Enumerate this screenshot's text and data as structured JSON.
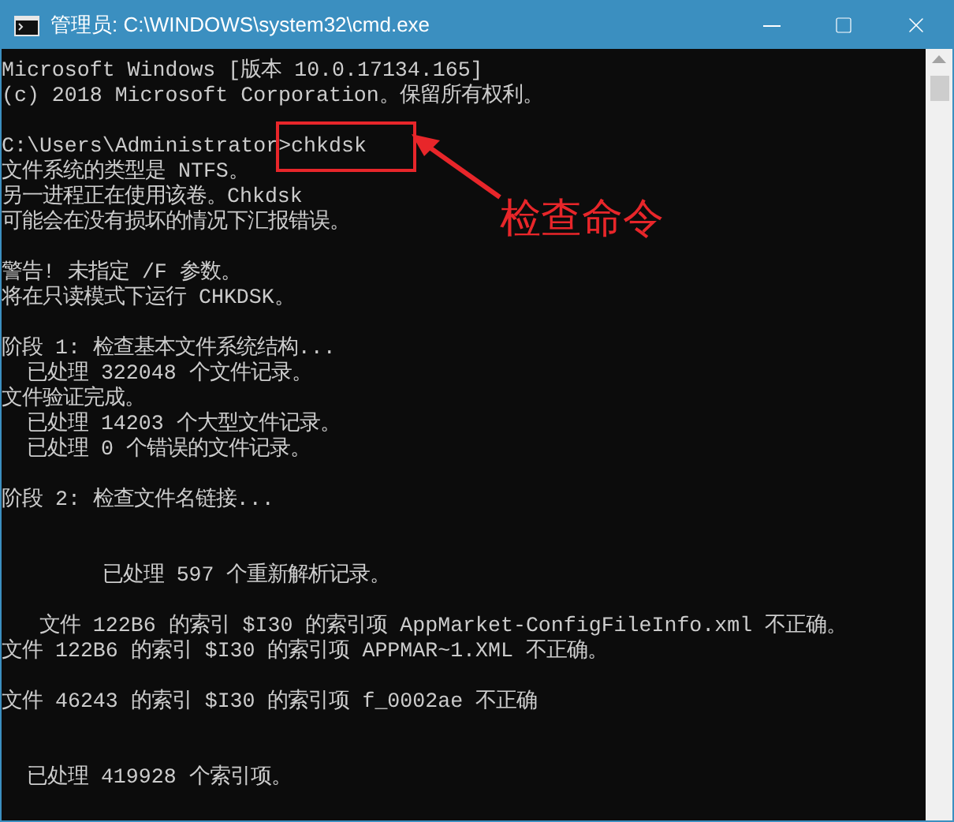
{
  "window": {
    "title": "管理员: C:\\WINDOWS\\system32\\cmd.exe"
  },
  "console": {
    "lines": [
      {
        "kind": "text",
        "text": "Microsoft Windows [版本 10.0.17134.165]"
      },
      {
        "kind": "text",
        "text": "(c) 2018 Microsoft Corporation。保留所有权利。"
      },
      {
        "kind": "blank"
      },
      {
        "kind": "prompt",
        "prompt": "C:\\Users\\Administrator",
        "command": ">chkdsk",
        "highlighted": true
      },
      {
        "kind": "text",
        "text": "文件系统的类型是 NTFS。"
      },
      {
        "kind": "text",
        "text": "另一进程正在使用该卷。Chkdsk"
      },
      {
        "kind": "text",
        "text": "可能会在没有损坏的情况下汇报错误。"
      },
      {
        "kind": "blank"
      },
      {
        "kind": "text",
        "text": "警告! 未指定 /F 参数。"
      },
      {
        "kind": "text",
        "text": "将在只读模式下运行 CHKDSK。"
      },
      {
        "kind": "blank"
      },
      {
        "kind": "text",
        "text": "阶段 1: 检查基本文件系统结构..."
      },
      {
        "kind": "text",
        "text": "  已处理 322048 个文件记录。"
      },
      {
        "kind": "text",
        "text": "文件验证完成。"
      },
      {
        "kind": "text",
        "text": "  已处理 14203 个大型文件记录。"
      },
      {
        "kind": "text",
        "text": "  已处理 0 个错误的文件记录。"
      },
      {
        "kind": "blank"
      },
      {
        "kind": "text",
        "text": "阶段 2: 检查文件名链接..."
      },
      {
        "kind": "blank"
      },
      {
        "kind": "blank"
      },
      {
        "kind": "text",
        "text": "        已处理 597 个重新解析记录。"
      },
      {
        "kind": "blank"
      },
      {
        "kind": "text",
        "text": "   文件 122B6 的索引 $I30 的索引项 AppMarket-ConfigFileInfo.xml 不正确。"
      },
      {
        "kind": "text",
        "text": "文件 122B6 的索引 $I30 的索引项 APPMAR~1.XML 不正确。"
      },
      {
        "kind": "blank"
      },
      {
        "kind": "text",
        "text": "文件 46243 的索引 $I30 的索引项 f_0002ae 不正确"
      },
      {
        "kind": "blank"
      },
      {
        "kind": "blank"
      },
      {
        "kind": "text",
        "text": "  已处理 419928 个索引项。"
      }
    ]
  },
  "annotation": {
    "label": "检查命令"
  }
}
